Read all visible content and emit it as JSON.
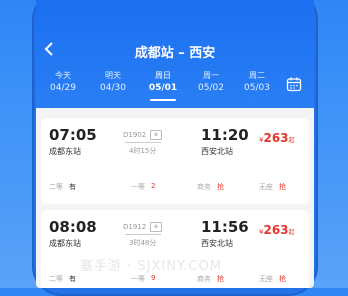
{
  "header": {
    "back_icon": "chevron-left-icon",
    "title": "成都站 – 西安"
  },
  "date_tabs": [
    {
      "weekday": "今天",
      "date": "04/29",
      "active": false
    },
    {
      "weekday": "明天",
      "date": "04/30",
      "active": false
    },
    {
      "weekday": "周日",
      "date": "05/01",
      "active": true
    },
    {
      "weekday": "周一",
      "date": "05/02",
      "active": false
    },
    {
      "weekday": "周二",
      "date": "05/03",
      "active": false
    }
  ],
  "calendar_icon": "calendar-icon",
  "trains": [
    {
      "depart_time": "07:05",
      "depart_station": "成都东站",
      "train_no": "D1902",
      "seat_icon_label": "⊕",
      "duration": "4时15分",
      "arrive_time": "11:20",
      "arrive_station": "西安北站",
      "price_symbol": "¥",
      "price": "263",
      "price_suffix": "起",
      "seats": [
        {
          "label": "二等",
          "value": "有"
        },
        {
          "label": "一等",
          "value": "2"
        },
        {
          "label": "商务",
          "value": "抢"
        },
        {
          "label": "无座",
          "value": "抢"
        }
      ]
    },
    {
      "depart_time": "08:08",
      "depart_station": "成都东站",
      "train_no": "D1912",
      "seat_icon_label": "⊕",
      "duration": "3时48分",
      "arrive_time": "11:56",
      "arrive_station": "西安北站",
      "price_symbol": "¥",
      "price": "263",
      "price_suffix": "起",
      "seats": [
        {
          "label": "二等",
          "value": "有"
        },
        {
          "label": "一等",
          "value": "9"
        },
        {
          "label": "商务",
          "value": "抢"
        },
        {
          "label": "无座",
          "value": "抢"
        }
      ]
    }
  ],
  "watermark": "塞手游 · SJXINY.COM",
  "colors": {
    "brand": "#1b6ff0",
    "price": "#e5372e"
  }
}
